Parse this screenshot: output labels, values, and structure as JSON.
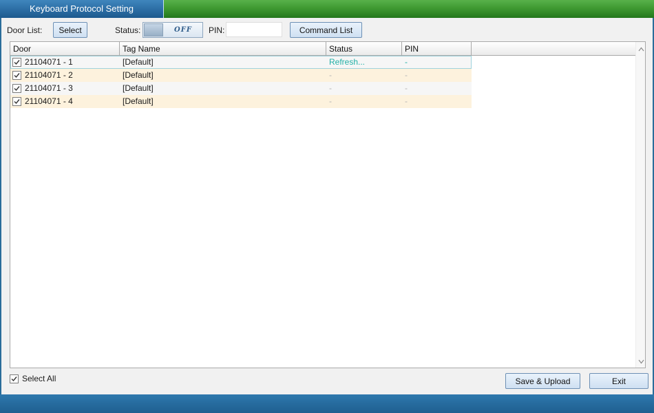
{
  "window": {
    "title": "Keyboard Protocol Setting"
  },
  "toolbar": {
    "door_list_label": "Door List:",
    "select_label": "Select",
    "status_label": "Status:",
    "status_toggle": "OFF",
    "pin_label": "PIN:",
    "pin_value": "",
    "command_list_label": "Command List"
  },
  "table": {
    "columns": [
      "Door",
      "Tag Name",
      "Status",
      "PIN"
    ],
    "rows": [
      {
        "checked": true,
        "door": "21104071 - 1",
        "tag": "[Default]",
        "status": "Refresh...",
        "pin": "-"
      },
      {
        "checked": true,
        "door": "21104071 - 2",
        "tag": "[Default]",
        "status": "-",
        "pin": "-"
      },
      {
        "checked": true,
        "door": "21104071 - 3",
        "tag": "[Default]",
        "status": "-",
        "pin": "-"
      },
      {
        "checked": true,
        "door": "21104071 - 4",
        "tag": "[Default]",
        "status": "-",
        "pin": "-"
      }
    ]
  },
  "footer": {
    "select_all_label": "Select All",
    "select_all_checked": true,
    "save_upload_label": "Save & Upload",
    "exit_label": "Exit"
  },
  "colors": {
    "title_bar_green": "#3f9a32",
    "title_tab_blue": "#2d6fa6",
    "status_refresh": "#21b0a6",
    "row_alt": "#fdf2dd"
  },
  "icons": {
    "checkbox": "checkmark-icon",
    "scroll_up": "chevron-up-icon",
    "scroll_down": "chevron-down-icon"
  }
}
